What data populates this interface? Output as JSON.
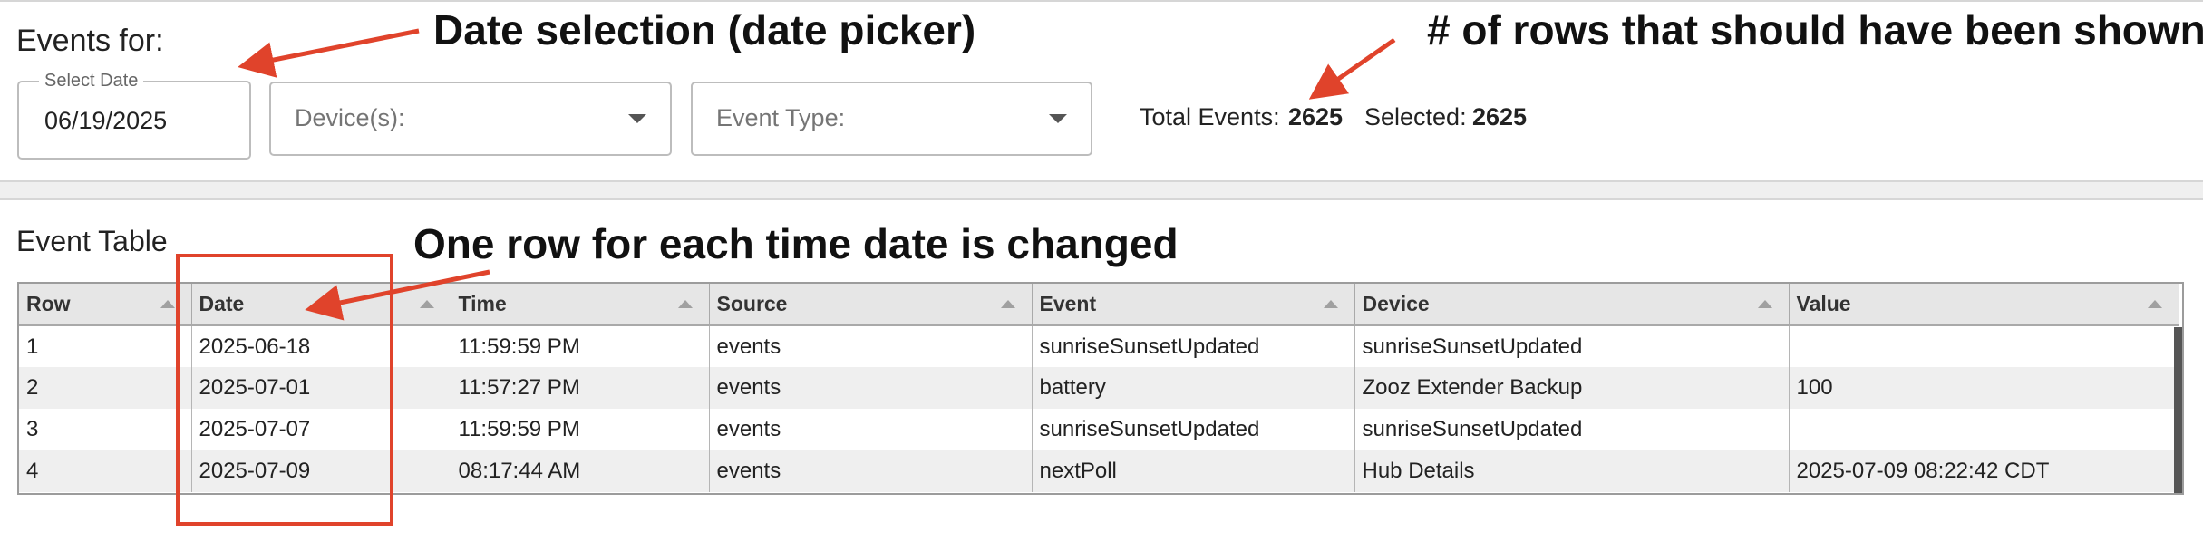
{
  "header": {
    "title": "Events for:",
    "date_picker": {
      "legend": "Select Date",
      "value": "06/19/2025"
    },
    "devices_select": {
      "placeholder": "Device(s):"
    },
    "event_type_select": {
      "placeholder": "Event Type:"
    },
    "totals": {
      "total_label": "Total Events:",
      "total_value": "2625",
      "selected_label": "Selected:",
      "selected_value": "2625"
    }
  },
  "table": {
    "title": "Event Table",
    "columns": [
      "Row",
      "Date",
      "Time",
      "Source",
      "Event",
      "Device",
      "Value"
    ],
    "rows": [
      [
        "1",
        "2025-06-18",
        "11:59:59 PM",
        "events",
        "sunriseSunsetUpdated",
        "sunriseSunsetUpdated",
        ""
      ],
      [
        "2",
        "2025-07-01",
        "11:57:27 PM",
        "events",
        "battery",
        "Zooz Extender Backup",
        "100"
      ],
      [
        "3",
        "2025-07-07",
        "11:59:59 PM",
        "events",
        "sunriseSunsetUpdated",
        "sunriseSunsetUpdated",
        ""
      ],
      [
        "4",
        "2025-07-09",
        "08:17:44 AM",
        "events",
        "nextPoll",
        "Hub Details",
        "2025-07-09 08:22:42 CDT"
      ]
    ]
  },
  "annotations": {
    "date_picker_note": "Date selection (date picker)",
    "rows_note": "# of rows that should have been shown",
    "date_column_note": "One row for each time date is changed",
    "color": "#e0432b"
  }
}
